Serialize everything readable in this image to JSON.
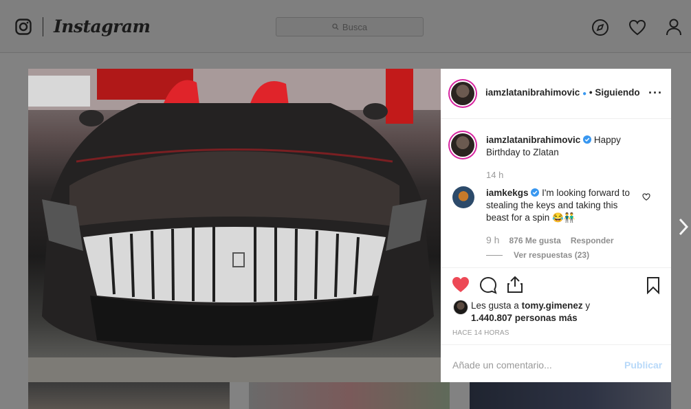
{
  "nav": {
    "wordmark": "Instagram",
    "search_placeholder": "Busca"
  },
  "post": {
    "author": "iamzlatanibrahimovic",
    "follow_status": "• Siguiendo",
    "caption_author": "iamzlatanibrahimovic",
    "caption_text": "Happy Birthday to Zlatan",
    "caption_time": "14 h",
    "comment": {
      "author": "iamkekgs",
      "text": "I'm looking forward to stealing the keys and taking this beast for a spin 😂👬",
      "time": "9 h",
      "likes": "876 Me gusta",
      "reply_label": "Responder",
      "view_replies": "Ver respuestas (23)"
    },
    "likes_prefix": "Les gusta a",
    "liked_by": "tomy.gimenez",
    "likes_and": "y",
    "likes_count": "1.440.807 personas más",
    "posted_ago": "HACE 14 HORAS",
    "add_comment_placeholder": "Añade un comentario...",
    "publish_label": "Publicar"
  },
  "colors": {
    "accent": "#3897f0",
    "like_red": "#ed4956",
    "story_ring": "#d6249f"
  }
}
